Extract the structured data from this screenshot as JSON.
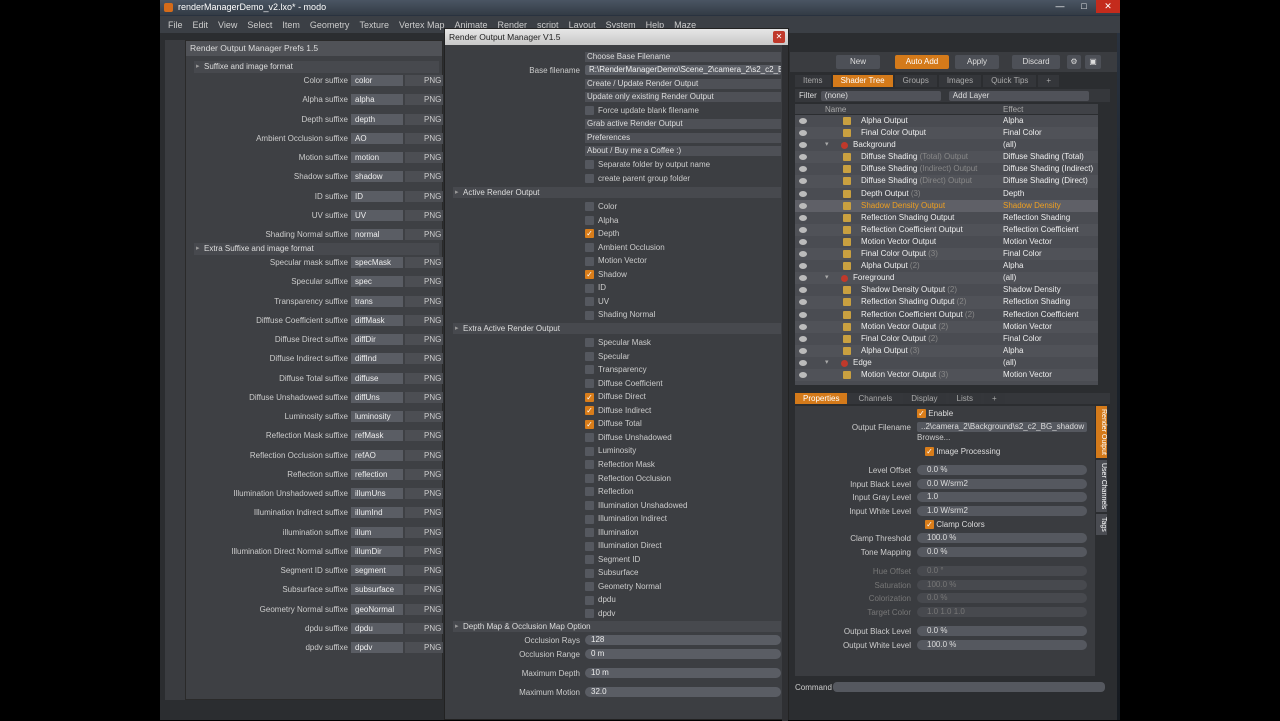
{
  "window_title": "renderManagerDemo_v2.lxo* - modo",
  "window_buttons": [
    "—",
    "□",
    "✕"
  ],
  "menu": [
    "File",
    "Edit",
    "View",
    "Select",
    "Item",
    "Geometry",
    "Texture",
    "Vertex Map",
    "Animate",
    "Render",
    "script",
    "Layout",
    "System",
    "Help",
    "Maze"
  ],
  "toolbar": {
    "new": "New",
    "auto_add": "Auto Add",
    "apply": "Apply",
    "discard": "Discard"
  },
  "shader_tabs": [
    "Items",
    "Shader Tree",
    "Groups",
    "Images",
    "Quick Tips",
    "+"
  ],
  "filter": {
    "label": "Filter",
    "value": "(none)",
    "add_layer": "Add Layer"
  },
  "tree_head": {
    "name": "Name",
    "effect": "Effect"
  },
  "tree": [
    {
      "name": "Alpha Output",
      "sub": "",
      "effect": "Alpha",
      "indent": 1,
      "icon": "out"
    },
    {
      "name": "Final Color Output",
      "sub": "",
      "effect": "Final Color",
      "indent": 1,
      "icon": "out"
    },
    {
      "name": "Background",
      "sub": "",
      "effect": "(all)",
      "indent": 0,
      "icon": "grp"
    },
    {
      "name": "Diffuse Shading",
      "sub": " (Total) Output",
      "effect": "Diffuse Shading (Total)",
      "indent": 1,
      "icon": "out"
    },
    {
      "name": "Diffuse Shading",
      "sub": " (Indirect) Output",
      "effect": "Diffuse Shading (Indirect)",
      "indent": 1,
      "icon": "out"
    },
    {
      "name": "Diffuse Shading",
      "sub": " (Direct) Output",
      "effect": "Diffuse Shading (Direct)",
      "indent": 1,
      "icon": "out"
    },
    {
      "name": "Depth Output",
      "sub": " (3)",
      "effect": "Depth",
      "indent": 1,
      "icon": "out"
    },
    {
      "name": "Shadow Density Output",
      "sub": "",
      "effect": "Shadow Density",
      "indent": 1,
      "icon": "out",
      "sel": true
    },
    {
      "name": "Reflection Shading Output",
      "sub": "",
      "effect": "Reflection Shading",
      "indent": 1,
      "icon": "out"
    },
    {
      "name": "Reflection Coefficient Output",
      "sub": "",
      "effect": "Reflection Coefficient",
      "indent": 1,
      "icon": "out"
    },
    {
      "name": "Motion Vector Output",
      "sub": "",
      "effect": "Motion Vector",
      "indent": 1,
      "icon": "out"
    },
    {
      "name": "Final Color Output",
      "sub": " (3)",
      "effect": "Final Color",
      "indent": 1,
      "icon": "out"
    },
    {
      "name": "Alpha Output",
      "sub": " (2)",
      "effect": "Alpha",
      "indent": 1,
      "icon": "out"
    },
    {
      "name": "Foreground",
      "sub": "",
      "effect": "(all)",
      "indent": 0,
      "icon": "grp"
    },
    {
      "name": "Shadow Density Output",
      "sub": " (2)",
      "effect": "Shadow Density",
      "indent": 1,
      "icon": "out"
    },
    {
      "name": "Reflection Shading Output",
      "sub": " (2)",
      "effect": "Reflection Shading",
      "indent": 1,
      "icon": "out"
    },
    {
      "name": "Reflection Coefficient Output",
      "sub": " (2)",
      "effect": "Reflection Coefficient",
      "indent": 1,
      "icon": "out"
    },
    {
      "name": "Motion Vector Output",
      "sub": " (2)",
      "effect": "Motion Vector",
      "indent": 1,
      "icon": "out"
    },
    {
      "name": "Final Color Output",
      "sub": " (2)",
      "effect": "Final Color",
      "indent": 1,
      "icon": "out"
    },
    {
      "name": "Alpha Output",
      "sub": " (3)",
      "effect": "Alpha",
      "indent": 1,
      "icon": "out"
    },
    {
      "name": "Edge",
      "sub": "",
      "effect": "(all)",
      "indent": 0,
      "icon": "grp"
    },
    {
      "name": "Motion Vector Output",
      "sub": " (3)",
      "effect": "Motion Vector",
      "indent": 1,
      "icon": "out"
    }
  ],
  "prop_tabs": [
    "Properties",
    "Channels",
    "Display",
    "Lists",
    "+"
  ],
  "props": {
    "enable": "Enable",
    "output_filename_label": "Output Filename",
    "output_filename": "..2\\camera_2\\Background\\s2_c2_BG_shadow",
    "browse": "Browse...",
    "image_processing": "Image Processing",
    "clamp_colors": "Clamp Colors",
    "rows": [
      {
        "label": "Level Offset",
        "value": "0.0 %"
      },
      {
        "label": "Input Black Level",
        "value": "0.0 W/srm2"
      },
      {
        "label": "Input Gray Level",
        "value": "1.0"
      },
      {
        "label": "Input White Level",
        "value": "1.0 W/srm2"
      }
    ],
    "rows2": [
      {
        "label": "Clamp Threshold",
        "value": "100.0 %"
      },
      {
        "label": "Tone Mapping",
        "value": "0.0 %"
      }
    ],
    "dim_rows": [
      {
        "label": "Hue Offset",
        "value": "0.0 °"
      },
      {
        "label": "Saturation",
        "value": "100.0 %"
      },
      {
        "label": "Colorization",
        "value": "0.0 %"
      },
      {
        "label": "Target Color",
        "value": "1.0          1.0          1.0"
      }
    ],
    "rows3": [
      {
        "label": "Output Black Level",
        "value": "0.0 %"
      },
      {
        "label": "Output White Level",
        "value": "100.0 %"
      }
    ]
  },
  "vtabs": [
    "Render Output",
    "User Channels",
    "Tags"
  ],
  "command_label": "Command",
  "prefs": {
    "title": "Render Output Manager Prefs 1.5",
    "section1": "Suffixe and image format",
    "section2": "Extra Suffixe and image format",
    "format": "PNG",
    "rows1": [
      {
        "label": "Color suffixe",
        "value": "color"
      },
      {
        "label": "Alpha suffixe",
        "value": "alpha"
      },
      {
        "label": "Depth suffixe",
        "value": "depth"
      },
      {
        "label": "Ambient Occlusion suffixe",
        "value": "AO"
      },
      {
        "label": "Motion suffixe",
        "value": "motion"
      },
      {
        "label": "Shadow suffixe",
        "value": "shadow"
      },
      {
        "label": "ID suffixe",
        "value": "ID"
      },
      {
        "label": "UV suffixe",
        "value": "UV"
      },
      {
        "label": "Shading Normal suffixe",
        "value": "normal"
      }
    ],
    "rows2": [
      {
        "label": "Specular mask suffixe",
        "value": "specMask"
      },
      {
        "label": "Specular suffixe",
        "value": "spec"
      },
      {
        "label": "Transparency suffixe",
        "value": "trans"
      },
      {
        "label": "Difffuse Coefficient suffixe",
        "value": "diffMask"
      },
      {
        "label": "Diffuse Direct suffixe",
        "value": "diffDir"
      },
      {
        "label": "Diffuse Indirect suffixe",
        "value": "diffInd"
      },
      {
        "label": "Diffuse Total suffixe",
        "value": "diffuse"
      },
      {
        "label": "Diffuse Unshadowed suffixe",
        "value": "diffUns"
      },
      {
        "label": "Luminosity suffixe",
        "value": "luminosity"
      },
      {
        "label": "Reflection Mask suffixe",
        "value": "refMask"
      },
      {
        "label": "Reflection Occlusion suffixe",
        "value": "refAO"
      },
      {
        "label": "Reflection suffixe",
        "value": "reflection"
      },
      {
        "label": "Illumination  Unshadowed suffixe",
        "value": "illumUns"
      },
      {
        "label": "Illumination  Indirect suffixe",
        "value": "illumInd"
      },
      {
        "label": "illumination suffixe",
        "value": "illum"
      },
      {
        "label": "Illumination  Direct Normal suffixe",
        "value": "illumDir"
      },
      {
        "label": "Segment ID suffixe",
        "value": "segment"
      },
      {
        "label": "Subsurface suffixe",
        "value": "subsurface"
      },
      {
        "label": "Geometry Normal suffixe",
        "value": "geoNormal"
      },
      {
        "label": "dpdu suffixe",
        "value": "dpdu"
      },
      {
        "label": "dpdv suffixe",
        "value": "dpdv"
      }
    ]
  },
  "rmm": {
    "title": "Render Output Manager V1.5",
    "close": "✕",
    "choose_base": "Choose Base Filename",
    "base_label": "Base filename",
    "base_value": "R:\\RenderManagerDemo\\Scene_2\\camera_2\\s2_c2_BG",
    "create": "Create / Update Render Output",
    "update_only": "Update only existing Render Output",
    "force_update": "Force update blank filename",
    "grab": "Grab active Render Output",
    "preferences": "Preferences",
    "about": "About / Buy me a Coffee :)",
    "separate": "Separate folder by output name",
    "parent_group": "create parent group folder",
    "sect_active": "Active Render Output",
    "active": [
      {
        "label": "Color",
        "checked": false
      },
      {
        "label": "Alpha",
        "checked": false
      },
      {
        "label": "Depth",
        "checked": true
      },
      {
        "label": "Ambient Occlusion",
        "checked": false
      },
      {
        "label": "Motion Vector",
        "checked": false
      },
      {
        "label": "Shadow",
        "checked": true
      },
      {
        "label": "ID",
        "checked": false
      },
      {
        "label": "UV",
        "checked": false
      },
      {
        "label": "Shading Normal",
        "checked": false
      }
    ],
    "sect_extra": "Extra Active Render Output",
    "extra": [
      {
        "label": "Specular Mask",
        "checked": false
      },
      {
        "label": "Specular",
        "checked": false
      },
      {
        "label": "Transparency",
        "checked": false
      },
      {
        "label": "Diffuse Coefficient",
        "checked": false
      },
      {
        "label": "Diffuse Direct",
        "checked": true
      },
      {
        "label": "Diffuse Indirect",
        "checked": true
      },
      {
        "label": "Diffuse Total",
        "checked": true
      },
      {
        "label": "Diffuse Unshadowed",
        "checked": false
      },
      {
        "label": "Luminosity",
        "checked": false
      },
      {
        "label": "Reflection Mask",
        "checked": false
      },
      {
        "label": "Reflection Occlusion",
        "checked": false
      },
      {
        "label": "Reflection",
        "checked": false
      },
      {
        "label": "Illumination  Unshadowed",
        "checked": false
      },
      {
        "label": "Illumination  Indirect",
        "checked": false
      },
      {
        "label": "Illumination",
        "checked": false
      },
      {
        "label": "Illumination  Direct",
        "checked": false
      },
      {
        "label": "Segment ID",
        "checked": false
      },
      {
        "label": "Subsurface",
        "checked": false
      },
      {
        "label": "Geometry Normal",
        "checked": false
      },
      {
        "label": "dpdu",
        "checked": false
      },
      {
        "label": "dpdv",
        "checked": false
      }
    ],
    "sect_depth": "Depth Map & Occlusion Map Option",
    "fields": [
      {
        "label": "Occlusion Rays",
        "value": "128"
      },
      {
        "label": "Occlusion Range",
        "value": "0 m"
      },
      {
        "label": "Maximum Depth",
        "value": "10 m"
      },
      {
        "label": "Maximum Motion",
        "value": "32.0"
      }
    ]
  },
  "colors": {
    "accent": "#d47a1a",
    "check": "#d97d1a"
  }
}
